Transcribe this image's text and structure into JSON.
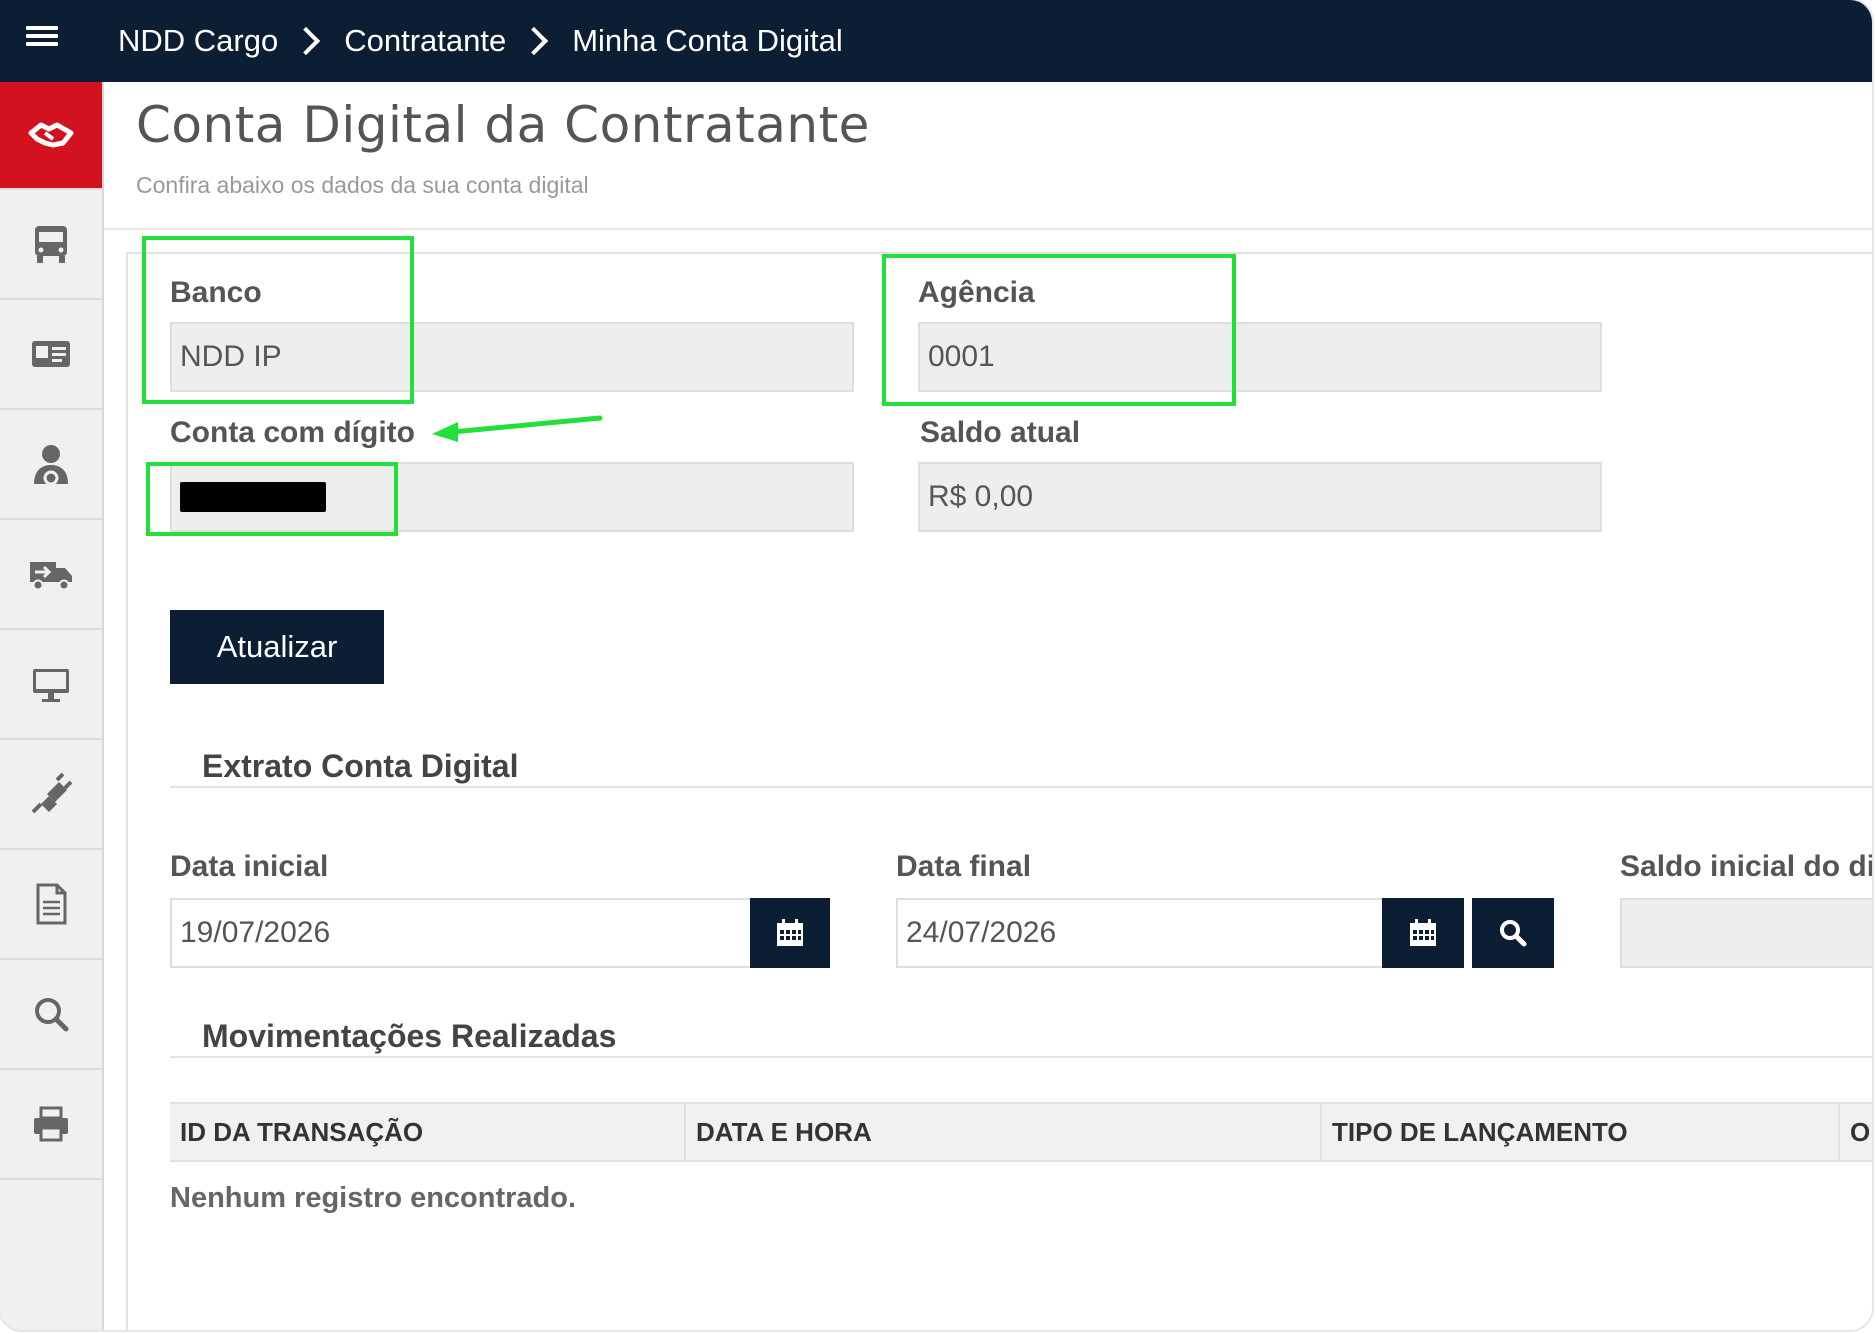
{
  "breadcrumb": [
    "NDD Cargo",
    "Contratante",
    "Minha Conta Digital"
  ],
  "sidebar": {
    "items": [
      {
        "icon": "handshake-icon",
        "active": true
      },
      {
        "icon": "truck-front-icon"
      },
      {
        "icon": "id-card-icon"
      },
      {
        "icon": "driver-icon"
      },
      {
        "icon": "delivery-truck-icon"
      },
      {
        "icon": "monitor-icon"
      },
      {
        "icon": "plug-icon"
      },
      {
        "icon": "document-icon"
      },
      {
        "icon": "search-icon"
      },
      {
        "icon": "printer-icon"
      }
    ]
  },
  "header": {
    "title": "Conta Digital da Contratante",
    "subtitle": "Confira abaixo os dados da sua conta digital"
  },
  "account": {
    "bank_label": "Banco",
    "bank_value": "NDD IP",
    "agency_label": "Agência",
    "agency_value": "0001",
    "account_label": "Conta com dígito",
    "balance_label": "Saldo atual",
    "balance_value": "R$ 0,00"
  },
  "update_button": "Atualizar",
  "statement": {
    "title": "Extrato Conta Digital",
    "start_label": "Data inicial",
    "start_value": "19/07/2026",
    "end_label": "Data final",
    "end_value": "24/07/2026",
    "opening_label": "Saldo inicial do di"
  },
  "movements": {
    "title": "Movimentações Realizadas",
    "columns": [
      "ID DA TRANSAÇÃO",
      "DATA E HORA",
      "TIPO DE LANÇAMENTO",
      "O"
    ],
    "empty_message": "Nenhum registro encontrado."
  },
  "colors": {
    "topbar": "#0c1e33",
    "sidebar_active": "#d2121e",
    "highlight": "#22e03a",
    "button": "#0c1e33"
  }
}
